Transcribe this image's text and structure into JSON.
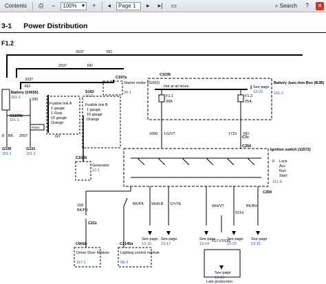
{
  "toolbar": {
    "contents_label": "Contents",
    "zoom_value": "100%",
    "page_value": "Page 1",
    "search_label": "Search"
  },
  "page": {
    "section_number": "3-1",
    "title": "Power Distribution",
    "subtitle": "F1.2"
  },
  "wires": {
    "w2037_top": "2037",
    "w2037_top_color": "RD",
    "w2037_mid": "2037",
    "w2037_mid_color": "RD",
    "w2037_low": "2037",
    "w2037_low_color": "RD",
    "w290": "290",
    "w1050": "1050",
    "w1050_color": "LG/VT",
    "w1715": "1715",
    "w1715_color": "RD",
    "w2057": "2057",
    "w8": "8",
    "w8_color": "BK",
    "w_bk_left": "BK",
    "w_gy": "GY",
    "w158": "158",
    "w158_color": "BK/PK",
    "w_bk_pk2": "BK/PK",
    "w_wh_lb": "WH/LB",
    "w_gy_ye": "GY/YE",
    "w_wh_vt": "WH/VT",
    "w_bk_bu": "BK/BU",
    "w717": "717",
    "w717_color": "VT/OG",
    "w5214": "5214",
    "w_nn": "7"
  },
  "components": {
    "battery_label": "Battery (10655)",
    "battery_ref": "151-1",
    "starter_connector": "C197a",
    "starter_label": "Starter motor (11002)",
    "starter_ref": "20-1",
    "c1100b": "C1100b",
    "fusible_a_title": "Fusible link A",
    "fusible_a_lines": [
      "1 gauge",
      "1 Gray",
      "10 gauge",
      "Orange"
    ],
    "fusible_b_title": "Fusible link B",
    "fusible_b_lines": [
      "1 gauge",
      "10 gauge",
      "Orange"
    ],
    "s162": "S162",
    "s162_ref": "10-2",
    "pulse_label": "Pulse",
    "c102b": "C102b",
    "generator_label": "Generator",
    "generator_ref": "12-1",
    "g100": "G100",
    "g100_ref": "151-1",
    "g101": "G101",
    "g101_ref": "151-1",
    "bjb_connector": "C1035",
    "hot_label": "Hot at all times",
    "bjb_label": "Battery Junc-tion Box (BJB)",
    "bjb_ref": "151-2",
    "see_page": "See page",
    "see_page_ref": "13-22",
    "f1_1_name": "F1.1",
    "f1_1_amps": "20A",
    "f1_2_name": "F1.2",
    "f1_2_amps": "25A",
    "c_s": "C250",
    "c_s_alt": "C7c",
    "ignition_label": "Ignition switch (11572)",
    "ign_positions": [
      "0",
      "Lock",
      "Acc",
      "Run",
      "Start"
    ],
    "ign_ref": "151-6",
    "c_ign": "C250",
    "c211": "C211",
    "c601b": "C601b",
    "driver_module": "Driver Door Module",
    "driver_module_ref": "117-1",
    "c2145a": "C2145a",
    "lighting_module": "Lighting control module",
    "lighting_module_ref": "58-3",
    "ref_a": "13-15",
    "ref_b": "13-17",
    "ref_c": "13-14",
    "ref_d": "13-22",
    "ref_e": "13-15",
    "ref_f": "13-33",
    "late_production": "Late production"
  }
}
